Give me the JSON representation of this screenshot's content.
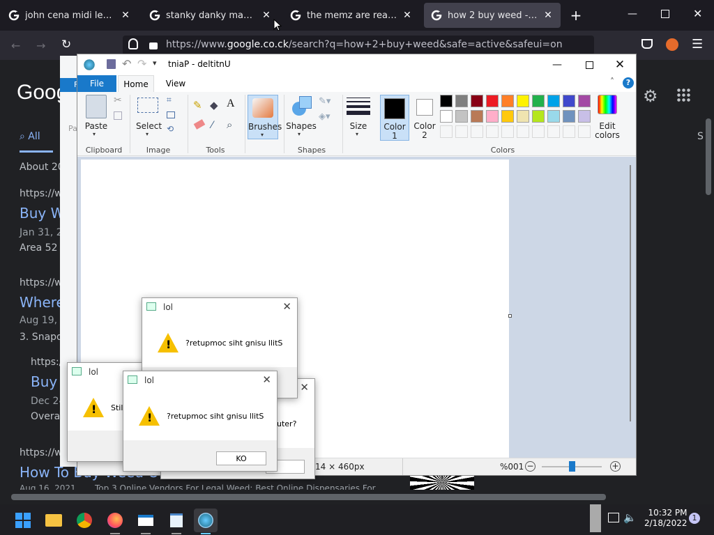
{
  "browser": {
    "tabs": [
      {
        "label": "john cena midi legit not co",
        "active": false
      },
      {
        "label": "stanky danky maymays - G",
        "active": false
      },
      {
        "label": "the memz are real - Google",
        "active": false
      },
      {
        "label": "how 2 buy weed - Google",
        "active": true
      }
    ],
    "url_prefix": "https://www.",
    "url_domain": "google.co.ck",
    "url_suffix": "/search?q=how+2+buy+weed&safe=active&safeui=on"
  },
  "google": {
    "logo": "Goog",
    "tab_all": "All",
    "about": "About 20",
    "results": [
      {
        "cite": "https://ww",
        "title": "Buy W",
        "date": "Jan 31, 2",
        "snippet": "Area 52"
      },
      {
        "cite": "https://ww",
        "title": "Where",
        "date": "Aug 19, 2",
        "snippet": "3. Snapd"
      },
      {
        "cite": "https://",
        "title": "Buy",
        "date": "Dec 24",
        "snippet": "Overall"
      },
      {
        "cite": "https://www",
        "title": "How To Buy Weed Onl",
        "date": "Aug 16, 2021",
        "snippet": "Top 3 Online Vendors For Legal Weed: Best Online Dispensaries For"
      }
    ],
    "right_edge": "S"
  },
  "paint": {
    "title": "tniaP - deltitnU",
    "tabs": {
      "file": "File",
      "home": "Home",
      "view": "View"
    },
    "behind_file": "F",
    "behind_pa": "Pa",
    "buttons": {
      "paste": "Paste",
      "select": "Select",
      "brushes": "Brushes",
      "shapes": "Shapes",
      "size": "Size",
      "color1_line1": "Color",
      "color1_line2": "1",
      "color2_line1": "Color",
      "color2_line2": "2",
      "edit_colors_line1": "Edit",
      "edit_colors_line2": "colors"
    },
    "groups": {
      "clipboard": "Clipboard",
      "image": "Image",
      "tools": "Tools",
      "shapes": "Shapes",
      "colors": "Colors"
    },
    "status": {
      "size": "14 × 460px",
      "zoom": "%001"
    },
    "palette_row1": [
      "#000000",
      "#7f7f7f",
      "#880015",
      "#ed1c24",
      "#ff7f27",
      "#fff200",
      "#22b14c",
      "#00a2e8",
      "#3f48cc",
      "#a349a4"
    ],
    "palette_row2": [
      "#ffffff",
      "#c3c3c3",
      "#b97a57",
      "#ffaec9",
      "#ffc90e",
      "#efe4b0",
      "#b5e61d",
      "#99d9ea",
      "#7092be",
      "#c8bfe7"
    ]
  },
  "dialogs": {
    "title": "lol",
    "message": "?retupmoc siht gnisu llitS",
    "partial_message": "Still",
    "partial_message2": "uter?",
    "ok_label": "KO",
    "ok_partial": "K"
  },
  "taskbar": {
    "time": "10:32 PM",
    "date": "2/18/2022",
    "notification_count": "1"
  }
}
